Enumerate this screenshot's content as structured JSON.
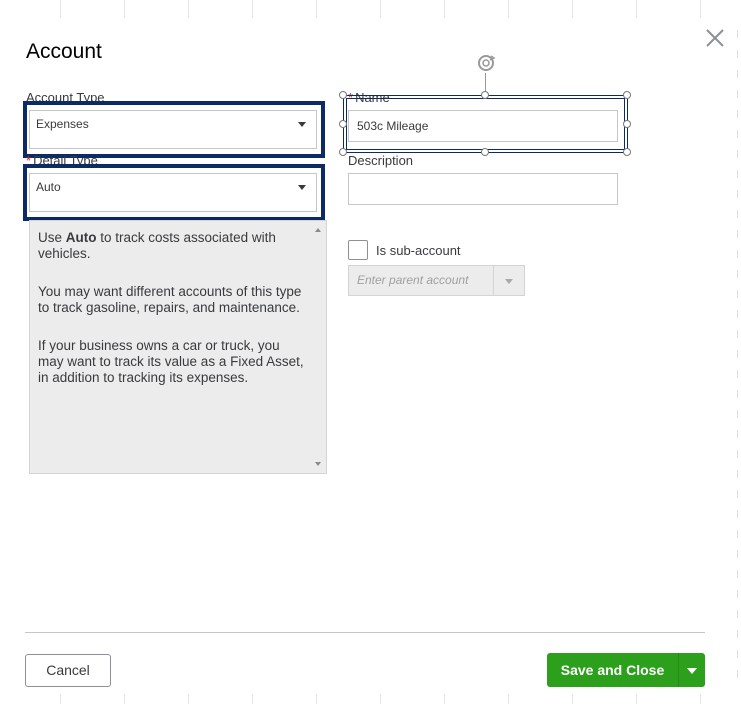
{
  "dialog": {
    "title": "Account",
    "close_icon": "close-icon"
  },
  "account_type": {
    "label": "Account Type",
    "value": "Expenses"
  },
  "detail_type": {
    "required_mark": "*",
    "label": "Detail Type",
    "value": "Auto"
  },
  "detail_description": {
    "para1_prefix": "Use ",
    "para1_bold": "Auto",
    "para1_suffix": " to track costs associated with vehicles.",
    "para2": "You may want different accounts of this type to track gasoline, repairs, and maintenance.",
    "para3": "If your business owns a car or truck, you may want to track its value as a Fixed Asset, in addition to tracking its expenses."
  },
  "name": {
    "required_mark": "*",
    "label": "Name",
    "value": "503c Mileage"
  },
  "description": {
    "label": "Description",
    "value": ""
  },
  "sub_account": {
    "label": "Is sub-account",
    "checked": false,
    "parent_placeholder": "Enter parent account"
  },
  "footer": {
    "cancel_label": "Cancel",
    "save_label": "Save and Close"
  },
  "colors": {
    "accent_green": "#2ca01c",
    "focus_navy": "#0c2a63",
    "required_red": "#d52b1e"
  }
}
